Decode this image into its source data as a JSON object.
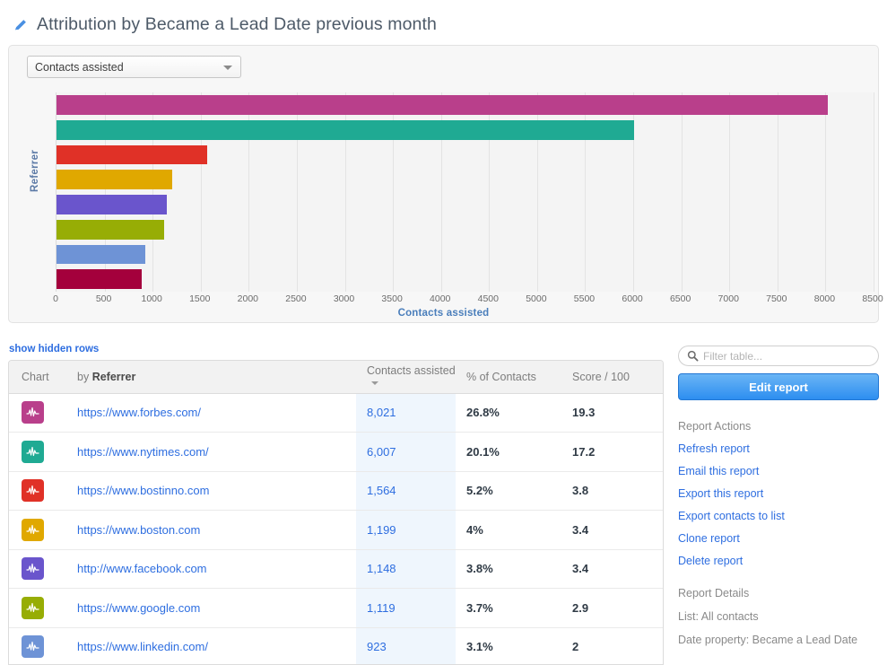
{
  "header": {
    "edit_icon": "pencil-icon",
    "title": "Attribution by Became a Lead Date previous month"
  },
  "chart_panel": {
    "metric_select": {
      "value": "Contacts assisted",
      "caret": "chevron-down-icon"
    }
  },
  "chart_data": {
    "type": "bar",
    "orientation": "horizontal",
    "title": "",
    "xlabel": "Contacts assisted",
    "ylabel": "Referrer",
    "xlim": [
      0,
      8500
    ],
    "xticks": [
      0,
      500,
      1000,
      1500,
      2000,
      2500,
      3000,
      3500,
      4000,
      4500,
      5000,
      5500,
      6000,
      6500,
      7000,
      7500,
      8000,
      8500
    ],
    "xtick_labels": [
      "0",
      "500",
      "1000",
      "1500",
      "2000",
      "2500",
      "3000",
      "3500",
      "4000",
      "4500",
      "5000",
      "5500",
      "6000",
      "6500",
      "7000",
      "7500",
      "8000",
      "8500"
    ],
    "grid": true,
    "legend": "none",
    "categories": [
      "https://www.forbes.com/",
      "https://www.nytimes.com/",
      "https://www.bostinno.com",
      "https://www.boston.com",
      "http://www.facebook.com",
      "https://www.google.com",
      "https://www.linkedin.com/"
    ],
    "values": [
      8021,
      6007,
      1564,
      1199,
      1148,
      1119,
      923
    ],
    "colors": [
      "#b93f8b",
      "#1faa93",
      "#e03127",
      "#e0a800",
      "#6a55cc",
      "#97ad05",
      "#6e93d6"
    ],
    "extra_series_color": "#a4003c"
  },
  "table_toggle": {
    "label": "show hidden rows"
  },
  "table": {
    "columns": [
      {
        "label": "Chart"
      },
      {
        "label_prefix": "by ",
        "label_strong": "Referrer"
      },
      {
        "label": "Contacts assisted",
        "sortable": true,
        "sort_icon": "chevron-down-icon"
      },
      {
        "label": "% of Contacts"
      },
      {
        "label": "Score / 100"
      }
    ],
    "rows": [
      {
        "color": "#b93f8b",
        "referrer": "https://www.forbes.com/",
        "contacts_assisted": "8,021",
        "pct_of_contacts": "26.8%",
        "score": "19.3"
      },
      {
        "color": "#1faa93",
        "referrer": "https://www.nytimes.com/",
        "contacts_assisted": "6,007",
        "pct_of_contacts": "20.1%",
        "score": "17.2"
      },
      {
        "color": "#e03127",
        "referrer": "https://www.bostinno.com",
        "contacts_assisted": "1,564",
        "pct_of_contacts": "5.2%",
        "score": "3.8"
      },
      {
        "color": "#e0a800",
        "referrer": "https://www.boston.com",
        "contacts_assisted": "1,199",
        "pct_of_contacts": "4%",
        "score": "3.4"
      },
      {
        "color": "#6a55cc",
        "referrer": "http://www.facebook.com",
        "contacts_assisted": "1,148",
        "pct_of_contacts": "3.8%",
        "score": "3.4"
      },
      {
        "color": "#97ad05",
        "referrer": "https://www.google.com",
        "contacts_assisted": "1,119",
        "pct_of_contacts": "3.7%",
        "score": "2.9"
      },
      {
        "color": "#6e93d6",
        "referrer": "https://www.linkedin.com/",
        "contacts_assisted": "923",
        "pct_of_contacts": "3.1%",
        "score": "2"
      }
    ]
  },
  "sidebar": {
    "filter": {
      "placeholder": "Filter table...",
      "value": "",
      "icon": "search-icon"
    },
    "edit_report_button": "Edit report",
    "actions_heading": "Report Actions",
    "actions": [
      "Refresh report",
      "Email this report",
      "Export this report",
      "Export contacts to list",
      "Clone report",
      "Delete report"
    ],
    "details_heading": "Report Details",
    "details": [
      "List: All contacts",
      "Date property: Became a Lead Date"
    ]
  }
}
